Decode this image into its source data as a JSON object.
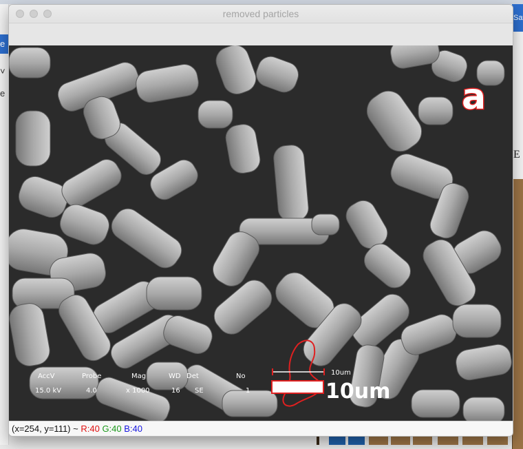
{
  "window": {
    "title": "removed particles"
  },
  "image": {
    "panel_label": "a",
    "scale_label_small": "10um",
    "scale_label_large": "10um",
    "sem_info": {
      "headers": [
        "AccV",
        "Probe",
        "Mag",
        "WD",
        "Det",
        "No"
      ],
      "values": [
        "15.0 kV",
        "4.0",
        "x 1000",
        "16",
        "SE",
        "1"
      ]
    }
  },
  "status": {
    "coords": "(x=254, y=111)",
    "sep": " ~ ",
    "r": "R:40",
    "g": "G:40",
    "b": "B:40"
  },
  "background": {
    "right_title_fragment": "Sav",
    "right_letter": "E",
    "left_glyph_1": "e",
    "left_glyph_2": "˅",
    "left_glyph_3": "e"
  },
  "colors": {
    "image_bg": "#2b2b2b",
    "selection_outline": "#e02020",
    "status_red": "#e01010",
    "status_green": "#1a9a1a",
    "status_blue": "#1515e0"
  }
}
